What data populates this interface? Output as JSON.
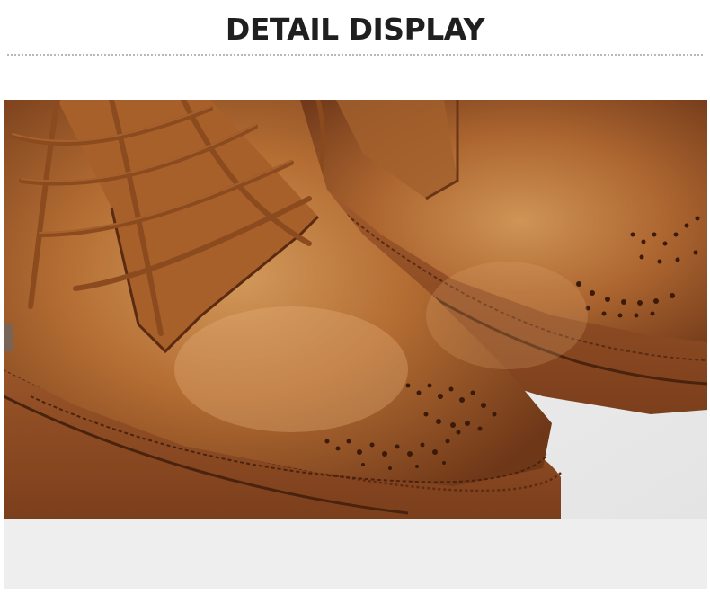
{
  "header": {
    "title": "DETAIL DISPLAY"
  },
  "image": {
    "subject": "shoe-photo",
    "colors": {
      "leather": "#a65f2c",
      "leather_light": "#c98a4f",
      "leather_dark": "#6b3617",
      "sole": "#9a542a",
      "background": "#f2f2f2",
      "band": "#eeeeee"
    }
  }
}
